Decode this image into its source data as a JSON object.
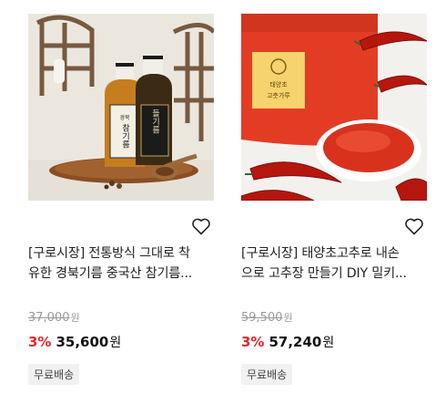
{
  "products": [
    {
      "title_line1": "[구로시장] 전통방식 그대로 착",
      "title_line2": "유한 경북기름 중국산 참기름...",
      "original_price": "37,000",
      "currency": "원",
      "discount_rate": "3%",
      "sale_price": "35,600",
      "shipping_badge": "무료배송",
      "image_labels": [
        "참기름",
        "들기름"
      ],
      "wishlist_icon": "heart-outline-icon"
    },
    {
      "title_line1": "[구로시장] 태양초고추로 내손",
      "title_line2": "으로 고추장 만들기 DIY 밀키...",
      "original_price": "59,500",
      "currency": "원",
      "discount_rate": "3%",
      "sale_price": "57,240",
      "shipping_badge": "무료배송",
      "image_labels": [
        "태양초",
        "고춧가루"
      ],
      "wishlist_icon": "heart-outline-icon"
    }
  ],
  "colors": {
    "discount": "#e52528",
    "price": "#111111",
    "original_price": "#9a9a9a",
    "badge_bg": "#f1f1f1"
  }
}
